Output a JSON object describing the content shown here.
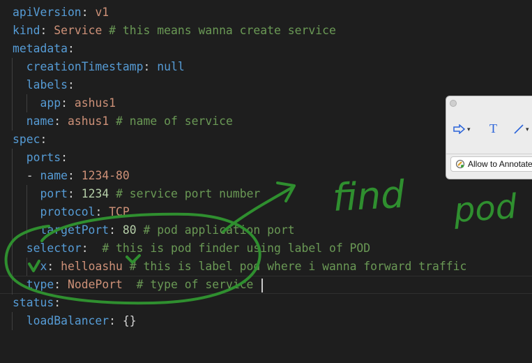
{
  "editor": {
    "lines": [
      {
        "id": "l1",
        "tokens": [
          {
            "t": "apiVersion",
            "c": "k"
          },
          {
            "t": ": ",
            "c": "p"
          },
          {
            "t": "v1",
            "c": "s"
          }
        ]
      },
      {
        "id": "l2",
        "tokens": [
          {
            "t": "kind",
            "c": "k"
          },
          {
            "t": ": ",
            "c": "p"
          },
          {
            "t": "Service",
            "c": "s"
          },
          {
            "t": " # this means wanna create service",
            "c": "c"
          }
        ]
      },
      {
        "id": "l3",
        "tokens": [
          {
            "t": "metadata",
            "c": "k"
          },
          {
            "t": ":",
            "c": "p"
          }
        ]
      },
      {
        "id": "l4",
        "tokens": [
          {
            "t": "  ",
            "c": "p"
          },
          {
            "t": "creationTimestamp",
            "c": "k"
          },
          {
            "t": ": ",
            "c": "p"
          },
          {
            "t": "null",
            "c": "k"
          }
        ]
      },
      {
        "id": "l5",
        "tokens": [
          {
            "t": "  ",
            "c": "p"
          },
          {
            "t": "labels",
            "c": "k"
          },
          {
            "t": ":",
            "c": "p"
          }
        ]
      },
      {
        "id": "l6",
        "tokens": [
          {
            "t": "    ",
            "c": "p"
          },
          {
            "t": "app",
            "c": "k"
          },
          {
            "t": ": ",
            "c": "p"
          },
          {
            "t": "ashus1",
            "c": "s"
          }
        ]
      },
      {
        "id": "l7",
        "tokens": [
          {
            "t": "  ",
            "c": "p"
          },
          {
            "t": "name",
            "c": "k"
          },
          {
            "t": ": ",
            "c": "p"
          },
          {
            "t": "ashus1",
            "c": "s"
          },
          {
            "t": " # name of service",
            "c": "c"
          }
        ]
      },
      {
        "id": "l8",
        "tokens": [
          {
            "t": "spec",
            "c": "k"
          },
          {
            "t": ":",
            "c": "p"
          }
        ]
      },
      {
        "id": "l9",
        "tokens": [
          {
            "t": "  ",
            "c": "p"
          },
          {
            "t": "ports",
            "c": "k"
          },
          {
            "t": ":",
            "c": "p"
          }
        ]
      },
      {
        "id": "l10",
        "tokens": [
          {
            "t": "  - ",
            "c": "p"
          },
          {
            "t": "name",
            "c": "k"
          },
          {
            "t": ": ",
            "c": "p"
          },
          {
            "t": "1234-80",
            "c": "s"
          }
        ]
      },
      {
        "id": "l11",
        "tokens": [
          {
            "t": "    ",
            "c": "p"
          },
          {
            "t": "port",
            "c": "k"
          },
          {
            "t": ": ",
            "c": "p"
          },
          {
            "t": "1234",
            "c": "n"
          },
          {
            "t": " # service port number",
            "c": "c"
          }
        ]
      },
      {
        "id": "l12",
        "tokens": [
          {
            "t": "    ",
            "c": "p"
          },
          {
            "t": "protocol",
            "c": "k"
          },
          {
            "t": ": ",
            "c": "p"
          },
          {
            "t": "TCP",
            "c": "s"
          }
        ]
      },
      {
        "id": "l13",
        "tokens": [
          {
            "t": "    ",
            "c": "p"
          },
          {
            "t": "targetPort",
            "c": "k"
          },
          {
            "t": ": ",
            "c": "p"
          },
          {
            "t": "80",
            "c": "n"
          },
          {
            "t": " # pod application port",
            "c": "c"
          }
        ]
      },
      {
        "id": "l14",
        "tokens": [
          {
            "t": "  ",
            "c": "p"
          },
          {
            "t": "selector",
            "c": "k"
          },
          {
            "t": ":  ",
            "c": "p"
          },
          {
            "t": "# this is pod finder using label of POD",
            "c": "c"
          }
        ]
      },
      {
        "id": "l15",
        "tokens": [
          {
            "t": "    ",
            "c": "p"
          },
          {
            "t": "x",
            "c": "k"
          },
          {
            "t": ": ",
            "c": "p"
          },
          {
            "t": "helloashu",
            "c": "s"
          },
          {
            "t": " # this is label pod where i wanna forward traffic",
            "c": "c"
          }
        ]
      },
      {
        "id": "l16",
        "tokens": [
          {
            "t": "  ",
            "c": "p"
          },
          {
            "t": "type",
            "c": "k"
          },
          {
            "t": ": ",
            "c": "p"
          },
          {
            "t": "NodePort",
            "c": "s"
          },
          {
            "t": "  # type of service ",
            "c": "c"
          }
        ],
        "current": true
      },
      {
        "id": "l17",
        "tokens": [
          {
            "t": "status",
            "c": "k"
          },
          {
            "t": ":",
            "c": "p"
          }
        ]
      },
      {
        "id": "l18",
        "tokens": [
          {
            "t": "  ",
            "c": "p"
          },
          {
            "t": "loadBalancer",
            "c": "k"
          },
          {
            "t": ": ",
            "c": "p"
          },
          {
            "t": "{}",
            "c": "p"
          }
        ]
      }
    ]
  },
  "annotation_toolbar": {
    "arrow_tool": "arrow-shape-icon",
    "text_tool_label": "T",
    "line_tool": "line-icon",
    "allow_label": "Allow to Annotate"
  },
  "handwriting": {
    "word1": "find",
    "word2": "pod"
  },
  "colors": {
    "background": "#1e1e1e",
    "key": "#569cd6",
    "string": "#ce9178",
    "number": "#b5cea8",
    "comment": "#6a9955",
    "ink": "#2f8f2f"
  }
}
